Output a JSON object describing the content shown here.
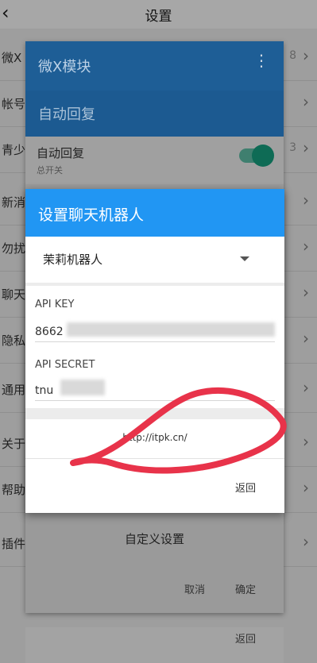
{
  "settings_page": {
    "title": "设置",
    "back_icon": "chevron-left-icon",
    "rows": [
      {
        "label": "微X",
        "value": "8"
      },
      {
        "label": "帐号",
        "value": ""
      },
      {
        "label": "青少",
        "value": "3"
      },
      {
        "label": "新消",
        "value": ""
      },
      {
        "label": "勿扰",
        "value": ""
      },
      {
        "label": "聊天",
        "value": ""
      },
      {
        "label": "隐私",
        "value": ""
      },
      {
        "label": "通用",
        "value": ""
      },
      {
        "label": "关于",
        "value": ""
      },
      {
        "label": "帮助",
        "value": ""
      },
      {
        "label": "插件",
        "value": ""
      }
    ]
  },
  "module_dialog": {
    "title": "微X模块",
    "menu_icon": "more-vert-icon",
    "section_title": "自动回复",
    "auto_reply": {
      "title": "自动回复",
      "subtitle": "总开关",
      "enabled": true
    },
    "custom_settings": "自定义设置",
    "cancel": "取消",
    "confirm": "确定",
    "back": "返回"
  },
  "bot_dialog": {
    "title": "设置聊天机器人",
    "selected_bot": "茉莉机器人",
    "api_key_label": "API KEY",
    "api_key_value": "8662",
    "api_secret_label": "API SECRET",
    "api_secret_value": "tnu",
    "link": "http://itpk.cn/",
    "back": "返回"
  },
  "colors": {
    "accent_blue": "#2196f3",
    "dark_blue": "#1e5e96",
    "switch_green": "#0e6b55",
    "scribble_red": "#e8334a"
  }
}
